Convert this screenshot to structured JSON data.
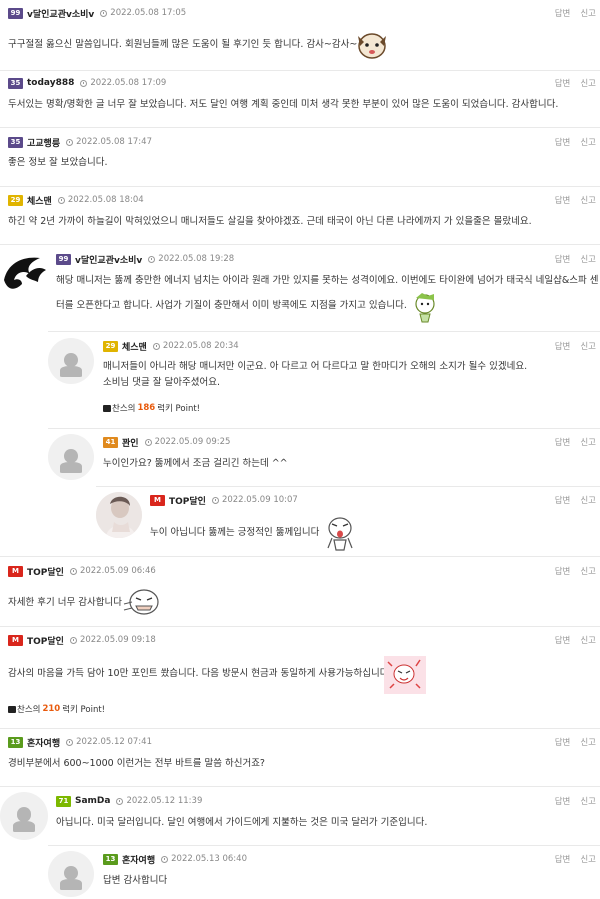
{
  "actions": {
    "reply": "답변",
    "report": "신고"
  },
  "comments": [
    {
      "level": "99",
      "author": "v달인교관v소비v",
      "date": "2022.05.08 17:05",
      "text": "구구절절 옳으신 말씀입니다. 회원님들께 많은 도움이 될 후기인 듯 합니다. 감사~감사~"
    },
    {
      "level": "35",
      "author": "today888",
      "date": "2022.05.08 17:09",
      "text": "두서있는 명확/명확한 글 너무 잘 보았습니다. 저도 달인 여행 계획 중인데 미처 생각 못한 부분이 있어 많은 도움이 되었습니다. 감사합니다."
    },
    {
      "level": "35",
      "author": "고교행릉",
      "date": "2022.05.08 17:47",
      "text": "좋은 정보 잘 보았습니다."
    },
    {
      "level": "29",
      "author": "체스맨",
      "date": "2022.05.08 18:04",
      "text": "하긴 약 2년 가까이 하늘길이 막혀있었으니 매니저들도 살길을 찾아야겠죠. 근데 태국이 아닌 다른 나라에까지 가 있을줄은 몰랐네요."
    },
    {
      "level": "99",
      "author": "v달인교관v소비v",
      "date": "2022.05.08 19:28",
      "text1": "해당 매니저는 뚫께 충만한 에너지 넘치는 아이라 원래 가만 있지를 못하는 성격이에요. 이번에도 타이완에 넘어가 태국식 네일샵&스파 센",
      "text2": "터를 오픈한다고 합니다. 사업가 기질이 충만해서 이미 방콕에도 지점을 가지고 있습니다."
    },
    {
      "level": "29",
      "author": "체스맨",
      "date": "2022.05.08 20:34",
      "text1": "매니저들이 아니라 해당 매니저만 이군요. 아 다르고 어 다르다고 말 한마디가 오해의 소지가 될수 있겠네요.",
      "text2": "소비님 댓글 잘 달아주셨어요.",
      "point_prefix": "찬스의",
      "point_num": "186",
      "point_suffix": "럭키 Point!"
    },
    {
      "level": "41",
      "author": "꽌인",
      "date": "2022.05.09 09:25",
      "text": "누이인가요?   뚫께에서 조금 걸리긴 하는데 ^^"
    },
    {
      "level": "M",
      "author": "TOP달인",
      "date": "2022.05.09 10:07",
      "text": "누이 아닙니다 뚫께는 긍정적인 뚫께입니다"
    },
    {
      "level": "M",
      "author": "TOP달인",
      "date": "2022.05.09 06:46",
      "text": "자세한 후기 너무 감사합니다"
    },
    {
      "level": "M",
      "author": "TOP달인",
      "date": "2022.05.09 09:18",
      "text": "감사의 마음을 가득 담아 10만 포인트 쐈습니다. 다음 방문시 현금과 동일하게 사용가능하십니다",
      "point_prefix": "찬스의",
      "point_num": "210",
      "point_suffix": "럭키 Point!"
    },
    {
      "level": "13",
      "author": "혼자여행",
      "date": "2022.05.12 07:41",
      "text": "경비부분에서 600~1000   이런거는 전부 바트를 말씀 하신거죠?"
    },
    {
      "level": "71",
      "author": "SamDa",
      "date": "2022.05.12 11:39",
      "text": "아닙니다. 미국 달러입니다. 달인 여행에서 가이드에게 지불하는 것은 미국 달러가 기준입니다."
    },
    {
      "level": "13",
      "author": "혼자여행",
      "date": "2022.05.13 06:40",
      "text": "답변 감사합니다"
    }
  ]
}
